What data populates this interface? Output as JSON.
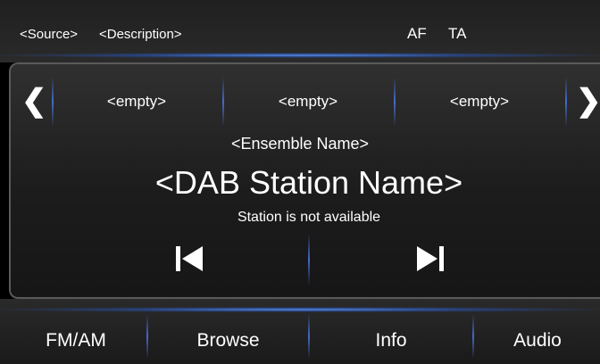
{
  "status_bar": {
    "source": "<Source>",
    "description": "<Description>",
    "af": "AF",
    "ta": "TA"
  },
  "presets": [
    "<empty>",
    "<empty>",
    "<empty>"
  ],
  "nav": {
    "prev_icon": "chevron-left-icon",
    "next_icon": "chevron-right-icon"
  },
  "station": {
    "ensemble": "<Ensemble Name>",
    "name": "<DAB Station Name>",
    "availability": "Station is not available"
  },
  "controls": {
    "prev_icon": "skip-previous-icon",
    "next_icon": "skip-next-icon"
  },
  "bottom_tabs": [
    "FM/AM",
    "Browse",
    "Info",
    "Audio"
  ],
  "colors": {
    "accent": "#4a7ddc",
    "background": "#000000",
    "text": "#ffffff"
  }
}
